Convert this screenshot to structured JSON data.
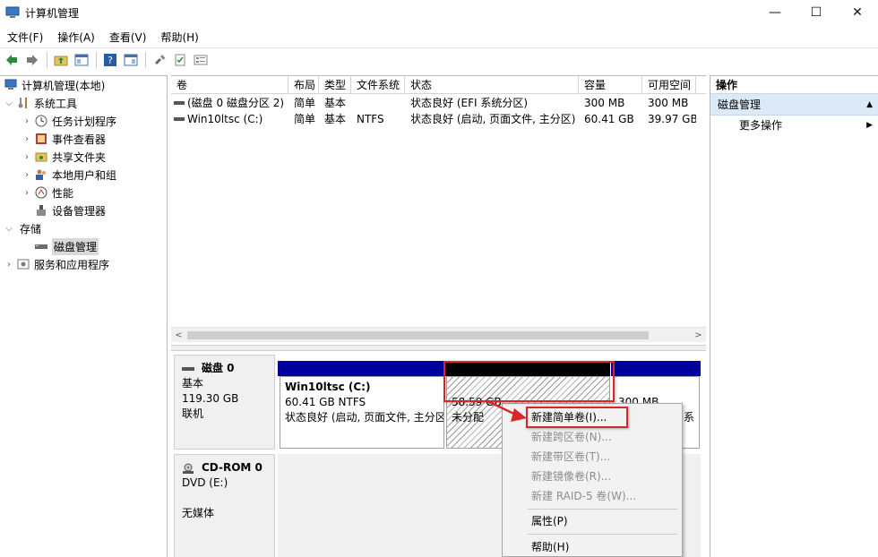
{
  "window": {
    "title": "计算机管理",
    "minimize": "—",
    "maximize": "☐",
    "close": "✕"
  },
  "menu": [
    "文件(F)",
    "操作(A)",
    "查看(V)",
    "帮助(H)"
  ],
  "tree": {
    "root": "计算机管理(本地)",
    "system_tools": "系统工具",
    "task_scheduler": "任务计划程序",
    "event_viewer": "事件查看器",
    "shared_folders": "共享文件夹",
    "local_users": "本地用户和组",
    "performance": "性能",
    "device_manager": "设备管理器",
    "storage": "存储",
    "disk_management": "磁盘管理",
    "services_apps": "服务和应用程序"
  },
  "volumes": {
    "headers": [
      "卷",
      "布局",
      "类型",
      "文件系统",
      "状态",
      "容量",
      "可用空间"
    ],
    "rows": [
      [
        "(磁盘 0 磁盘分区 2)",
        "简单",
        "基本",
        "",
        "状态良好 (EFI 系统分区)",
        "300 MB",
        "300 MB"
      ],
      [
        "Win10ltsc (C:)",
        "简单",
        "基本",
        "NTFS",
        "状态良好 (启动, 页面文件, 主分区)",
        "60.41 GB",
        "39.97 GB"
      ]
    ]
  },
  "disk0": {
    "name": "磁盘 0",
    "type": "基本",
    "size": "119.30 GB",
    "status": "联机",
    "partition_c": {
      "name": "Win10ltsc  (C:)",
      "size": "60.41 GB NTFS",
      "status": "状态良好 (启动, 页面文件, 主分区"
    },
    "unallocated": {
      "size": "58.59 GB",
      "label": "未分配"
    },
    "efi": {
      "size": "300 MB",
      "status": "I 系"
    }
  },
  "cdrom": {
    "name": "CD-ROM 0",
    "drive": "DVD (E:)",
    "media": "无媒体"
  },
  "actions": {
    "header": "操作",
    "section": "磁盘管理",
    "more": "更多操作"
  },
  "context_menu": {
    "new_simple": "新建简单卷(I)...",
    "new_spanned": "新建跨区卷(N)...",
    "new_striped": "新建带区卷(T)...",
    "new_mirrored": "新建镜像卷(R)...",
    "new_raid5": "新建 RAID-5 卷(W)...",
    "properties": "属性(P)",
    "help": "帮助(H)"
  },
  "colors": {
    "primary_partition": "#00009c",
    "unallocated": "#000000",
    "highlight_box": "#d9262b",
    "action_section": "#dce9f6"
  }
}
